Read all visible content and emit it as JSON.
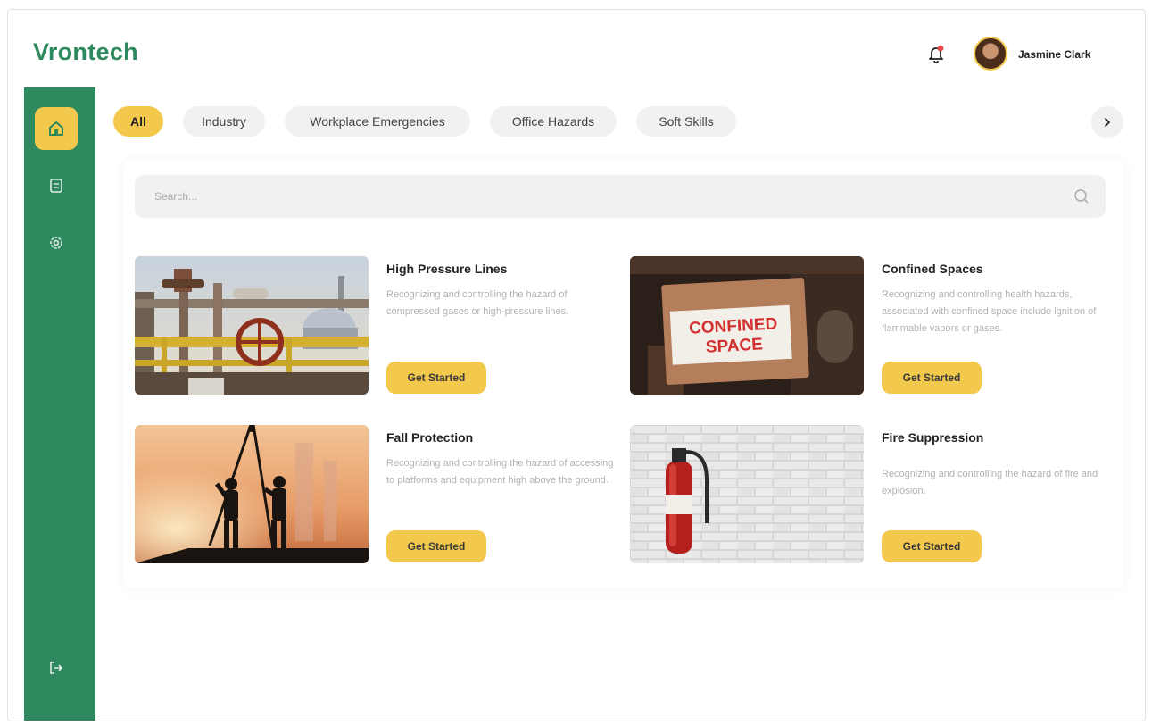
{
  "app": {
    "logo": "Vrontech"
  },
  "header": {
    "user_name": "Jasmine Clark",
    "notification_icon": "bell-icon",
    "avatar_icon": "user-avatar"
  },
  "sidebar": {
    "items": [
      {
        "icon": "home-icon",
        "active": true
      },
      {
        "icon": "document-icon",
        "active": false
      },
      {
        "icon": "settings-icon",
        "active": false
      }
    ],
    "logout_icon": "logout-icon"
  },
  "tabs": [
    {
      "label": "All",
      "active": true
    },
    {
      "label": "Industry",
      "active": false
    },
    {
      "label": "Workplace Emergencies",
      "active": false
    },
    {
      "label": "Office Hazards",
      "active": false
    },
    {
      "label": "Soft Skills",
      "active": false
    }
  ],
  "tabs_next_icon": "chevron-right-icon",
  "search": {
    "placeholder": "Search...",
    "icon": "search-icon"
  },
  "courses": [
    {
      "title": "High Pressure Lines",
      "description": "Recognizing and controlling the hazard of compressed gases or high-pressure lines.",
      "button": "Get Started"
    },
    {
      "title": "Confined Spaces",
      "description": "Recognizing and controlling health hazards, associated with confined space include ignition of flammable vapors or gases.",
      "button": "Get Started",
      "image_sign": [
        "CONFINED",
        "SPACE"
      ]
    },
    {
      "title": "Fall Protection",
      "description": "Recognizing and controlling the hazard of accessing to platforms and equipment high above the ground.",
      "button": "Get Started"
    },
    {
      "title": "Fire Suppression",
      "description": "Recognizing and controlling the hazard of fire and explosion.",
      "button": "Get Started"
    }
  ],
  "colors": {
    "brand_green": "#2e8a5e",
    "accent_yellow": "#f2c94c",
    "notification_red": "#e5484d"
  }
}
